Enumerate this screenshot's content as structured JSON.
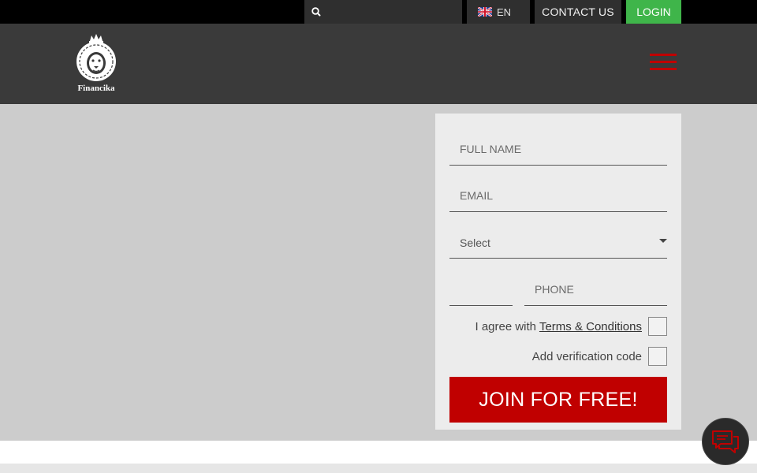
{
  "topbar": {
    "search": {
      "placeholder": "",
      "icon": "search-icon"
    },
    "language": {
      "code": "EN",
      "flag": "uk-flag-icon"
    },
    "contact_label": "CONTACT US",
    "login_label": "LOGIN"
  },
  "header": {
    "logo_text": "Financika",
    "menu_icon": "hamburger-menu-icon"
  },
  "form": {
    "full_name_placeholder": "FULL NAME",
    "email_placeholder": "EMAIL",
    "select_value": "Select",
    "phone_placeholder": "PHONE",
    "agree_prefix": "I agree with",
    "terms_link": "Terms & Conditions",
    "verification_label": "Add verification code",
    "submit_label": "JOIN FOR FREE!"
  },
  "chat": {
    "icon": "chat-bubbles-icon"
  },
  "colors": {
    "login_green": "#3fb54a",
    "join_red": "#c00000",
    "menu_red": "#c00000",
    "header_dark": "#3a3a3a"
  }
}
